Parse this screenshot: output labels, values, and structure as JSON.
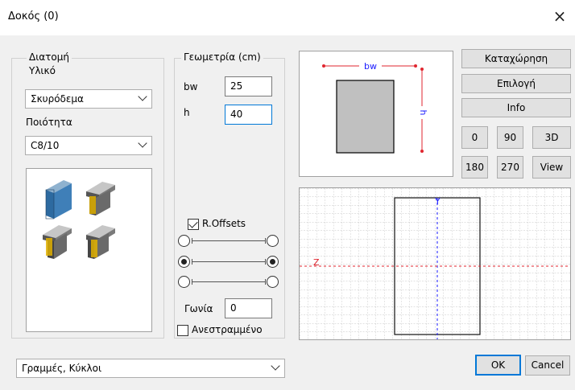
{
  "window": {
    "title": "Δοκός (0)",
    "close": "×"
  },
  "section": {
    "group_label": "Διατομή",
    "material_label": "Υλικό",
    "material_value": "Σκυρόδεμα",
    "quality_label": "Ποιότητα",
    "quality_value": "C8/10"
  },
  "geometry": {
    "group_label": "Γεωμετρία (cm)",
    "bw_label": "bw",
    "bw_value": "25",
    "h_label": "h",
    "h_value": "40",
    "roffsets_label": "R.Offsets",
    "roffsets_checked": true,
    "angle_label": "Γωνία",
    "angle_value": "0",
    "inverted_label": "Ανεστραμμένο",
    "inverted_checked": false
  },
  "preview": {
    "bw_dim": "bw",
    "h_dim": "h",
    "axis_y": "Y",
    "axis_z": "Z"
  },
  "buttons": {
    "register": "Καταχώρηση",
    "select": "Επιλογή",
    "info": "Info",
    "v0": "0",
    "v90": "90",
    "v3d": "3D",
    "v180": "180",
    "v270": "270",
    "view": "View",
    "ok": "OK",
    "cancel": "Cancel"
  },
  "bottom": {
    "lines_select": "Γραμμές, Κύκλοι"
  },
  "colors": {
    "accent": "#0078d7",
    "dimension_red": "#e0262f",
    "dimension_blue": "#1a1aff",
    "section_fill": "#c0c0c0"
  }
}
